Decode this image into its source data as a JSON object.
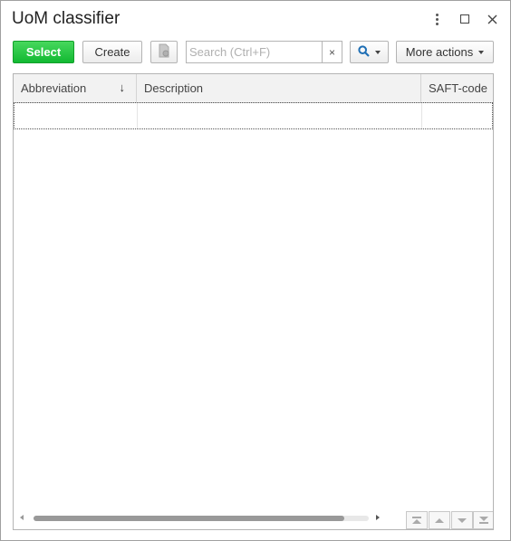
{
  "window": {
    "title": "UoM classifier",
    "controls": [
      "more-options-icon",
      "maximize-icon",
      "close-icon"
    ]
  },
  "toolbar": {
    "select_label": "Select",
    "create_label": "Create",
    "copy_icon": "copy-document-icon",
    "search_placeholder": "Search (Ctrl+F)",
    "search_value": "",
    "search_clear": "×",
    "search_icon": "magnifier-icon",
    "more_actions_label": "More actions"
  },
  "table": {
    "columns": [
      {
        "label": "Abbreviation",
        "sort": "↓"
      },
      {
        "label": "Description"
      },
      {
        "label": "SAFT-code"
      }
    ],
    "rows": []
  },
  "colors": {
    "select_button": "#12b932",
    "header_bg": "#f2f2f2",
    "border": "#b4b4b4"
  }
}
